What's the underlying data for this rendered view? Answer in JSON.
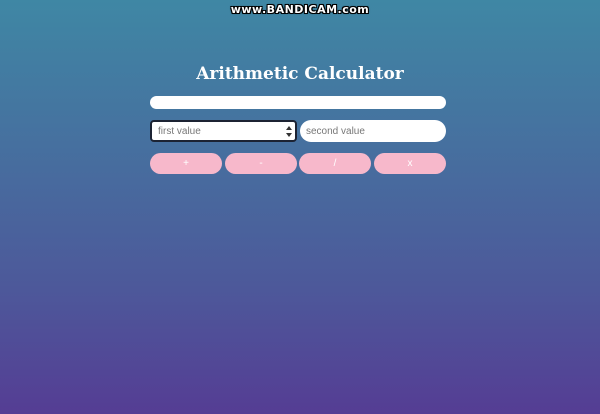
{
  "watermark": "www.BANDICAM.com",
  "title": "Arithmetic Calculator",
  "result": {
    "value": ""
  },
  "inputs": {
    "first_placeholder": "first value",
    "second_placeholder": "second value"
  },
  "operations": {
    "add": "+",
    "subtract": "-",
    "divide": "/",
    "multiply": "x"
  },
  "colors": {
    "background_top": "#3f87a4",
    "background_bottom": "#553d94",
    "button": "#f7b8cb",
    "title": "#ffffff"
  }
}
